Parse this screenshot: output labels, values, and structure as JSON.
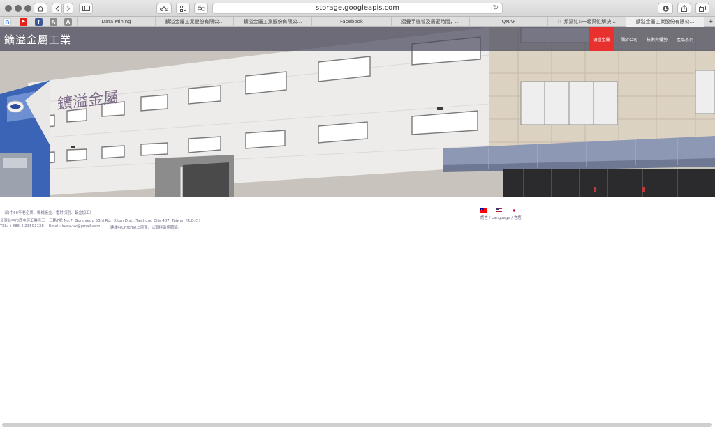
{
  "browser": {
    "url": "storage.googleapis.com",
    "tabs": [
      {
        "label": "Data Mining"
      },
      {
        "label": "鑛溢金屬工業股份有限公..."
      },
      {
        "label": "鑛溢金屬工業股份有限公..."
      },
      {
        "label": "Facebook"
      },
      {
        "label": "摺疊手機曾及需要時間，..."
      },
      {
        "label": "QNAP"
      },
      {
        "label": "iT 邦幫忙::一起幫忙解決..."
      },
      {
        "label": "鑛溢金屬工業股份有限公..."
      }
    ],
    "favorites": [
      {
        "icon": "google-icon",
        "glyph": "G",
        "color": "#ffffff"
      },
      {
        "icon": "youtube-icon",
        "glyph": "▶",
        "color": "#e62117"
      },
      {
        "icon": "facebook-icon",
        "glyph": "f",
        "color": "#3b5998"
      },
      {
        "icon": "letter-a-icon",
        "glyph": "A",
        "color": "#8c8c8c"
      },
      {
        "icon": "letter-a-icon",
        "glyph": "A",
        "color": "#8c8c8c"
      }
    ]
  },
  "site": {
    "title": "鑛溢金屬工業",
    "accent_color": "#e8312f",
    "nav": [
      {
        "label": "鑛溢金屬",
        "active": true
      },
      {
        "label": "關於公司",
        "active": false
      },
      {
        "label": "技術與優勢",
        "active": false
      },
      {
        "label": "產品系列",
        "active": false
      }
    ],
    "building_sign": "鑛溢金屬"
  },
  "footer": {
    "line1": "（台中60年老企業．機械板金．雷射切割．鈑金加工）",
    "line2": "台灣台中市西屯區工業區三十三路7號 No.7, Gongyequ 33rd Rd., Xitun Dist., Taichung City 407, Taiwan (R.O.C.)",
    "line3_tel": "TEL: +886-4-23593138",
    "line3_email": "Email: kudu.tw@gmail.com",
    "line3_note": "建議在Chrome上瀏覽，以取得最佳體驗。",
    "language_label": "語言 / Language / 言語"
  }
}
